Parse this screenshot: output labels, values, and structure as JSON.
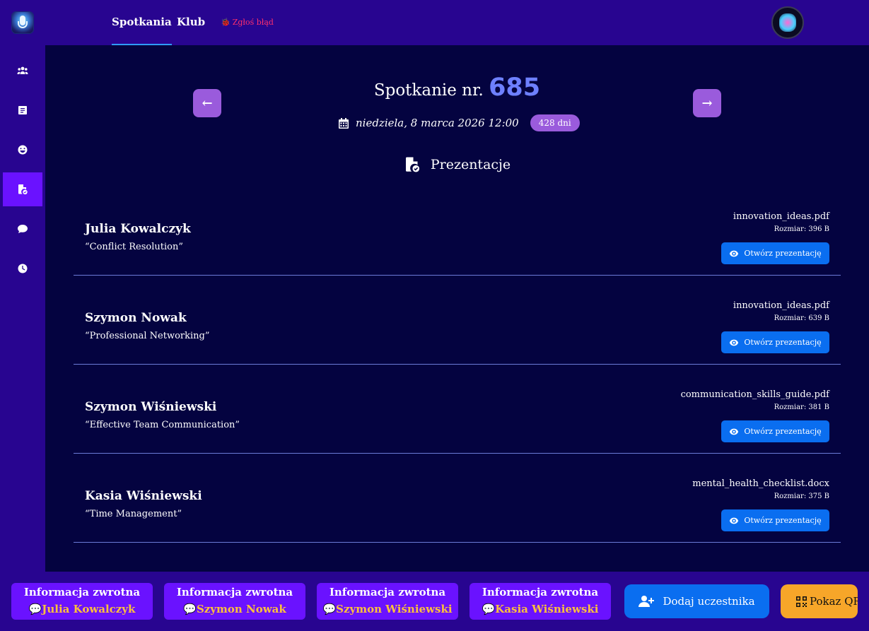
{
  "header": {
    "tabs": [
      {
        "label": "Spotkania",
        "active": true
      },
      {
        "label": "Klub",
        "active": false
      }
    ],
    "report_bug": "Zgłoś błąd"
  },
  "sidebar": {
    "items": [
      {
        "icon": "users-icon",
        "active": false
      },
      {
        "icon": "clipboard-icon",
        "active": false
      },
      {
        "icon": "smile-icon",
        "active": false
      },
      {
        "icon": "file-check-icon",
        "active": true
      },
      {
        "icon": "comment-icon",
        "active": false
      },
      {
        "icon": "clock-icon",
        "active": false
      }
    ]
  },
  "meeting": {
    "title_prefix": "Spotkanie nr.",
    "number": "685",
    "date": "niedziela, 8 marca 2026 12:00",
    "days_badge": "428 dni"
  },
  "section": {
    "title": "Prezentacje"
  },
  "presentations": [
    {
      "speaker": "Julia Kowalczyk",
      "topic": "“Conflict Resolution”",
      "file": "innovation_ideas.pdf",
      "size": "Rozmiar: 396 B",
      "button": "Otwórz prezentację"
    },
    {
      "speaker": "Szymon Nowak",
      "topic": "“Professional Networking”",
      "file": "innovation_ideas.pdf",
      "size": "Rozmiar: 639 B",
      "button": "Otwórz prezentację"
    },
    {
      "speaker": "Szymon Wiśniewski",
      "topic": "“Effective Team Communication”",
      "file": "communication_skills_guide.pdf",
      "size": "Rozmiar: 381 B",
      "button": "Otwórz prezentację"
    },
    {
      "speaker": "Kasia Wiśniewski",
      "topic": "“Time Management”",
      "file": "mental_health_checklist.docx",
      "size": "Rozmiar: 375 B",
      "button": "Otwórz prezentację"
    }
  ],
  "feedback": [
    {
      "label": "Informacja zwrotna",
      "name": "Julia Kowalczyk"
    },
    {
      "label": "Informacja zwrotna",
      "name": "Szymon Nowak"
    },
    {
      "label": "Informacja zwrotna",
      "name": "Szymon Wiśniewski"
    },
    {
      "label": "Informacja zwrotna",
      "name": "Kasia Wiśniewski"
    }
  ],
  "actions": {
    "add_participant": "Dodaj uczestnika",
    "show_qr": "Pokaz QR"
  },
  "colors": {
    "topbar": "#280590",
    "main_bg": "#040340",
    "accent_purple": "#6a12ff",
    "blue_button": "#0a6ef0",
    "orange_button": "#f7a629",
    "feedback_name": "#ffc13a",
    "meeting_number": "#6e80ff"
  }
}
